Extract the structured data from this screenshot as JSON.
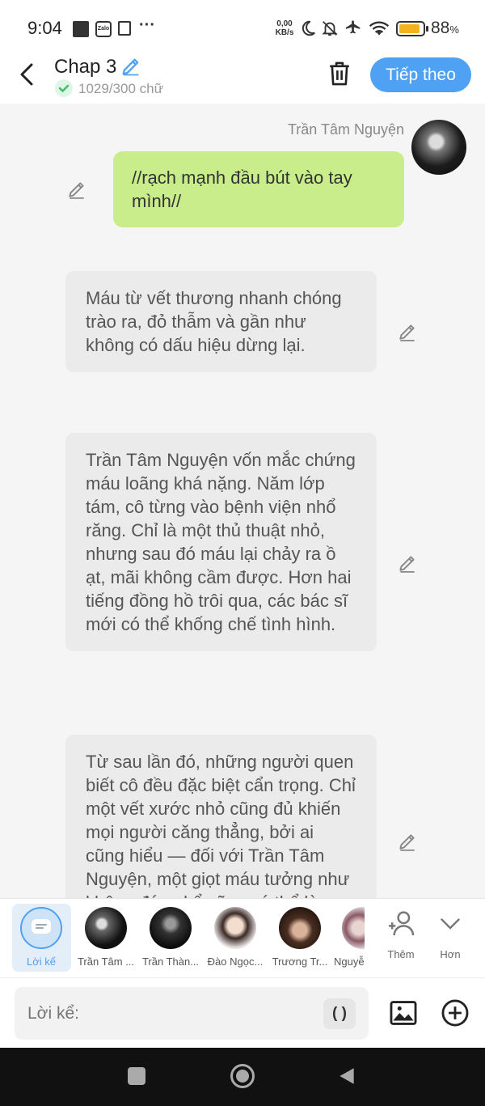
{
  "status_bar": {
    "time": "9:04",
    "zalo_label": "Zalo",
    "more": "···",
    "net_speed_value": "0,00",
    "net_speed_unit": "KB/s",
    "battery": "88",
    "battery_unit": "%"
  },
  "header": {
    "title": "Chap 3",
    "word_count": "1029/300 chữ",
    "next_label": "Tiếp theo"
  },
  "messages": [
    {
      "speaker": "Trần Tâm Nguyện",
      "text": "//rạch mạnh đầu bút vào tay mình//"
    },
    {
      "text": "Máu từ vết thương nhanh chóng trào ra, đỏ thẫm và gần như không có dấu hiệu dừng lại."
    },
    {
      "text": "Trần Tâm Nguyện vốn mắc chứng máu loãng khá nặng. Năm lớp tám, cô từng vào bệnh viện nhổ răng. Chỉ là một thủ thuật nhỏ, nhưng sau đó máu lại chảy ra ồ ạt, mãi không cầm được. Hơn hai tiếng đồng hồ trôi qua, các bác sĩ mới có thể khống chế tình hình."
    },
    {
      "text": "Từ sau lần đó, những người quen biết cô đều đặc biệt cẩn trọng. Chỉ một vết xước nhỏ cũng đủ khiến mọi người căng thẳng, bởi ai cũng hiểu — đối với Trần Tâm Nguyện, một giọt máu tưởng như không đáng kể cũng có thể là nguy hiểm."
    }
  ],
  "characters": [
    {
      "name": "Lời kể",
      "selected": true
    },
    {
      "name": "Trần Tâm ..."
    },
    {
      "name": "Trần Thàn..."
    },
    {
      "name": "Đào Ngọc..."
    },
    {
      "name": "Trương Tr..."
    },
    {
      "name": "Nguyễ"
    }
  ],
  "char_actions": {
    "add": "Thêm",
    "more": "Hơn"
  },
  "input": {
    "placeholder": "Lời kể:",
    "paren_button": "( )"
  },
  "colors": {
    "accent": "#4ea1f3",
    "user_bubble": "#c9ed8a",
    "narr_bubble": "#ebebeb",
    "check": "#3fbf6a"
  }
}
